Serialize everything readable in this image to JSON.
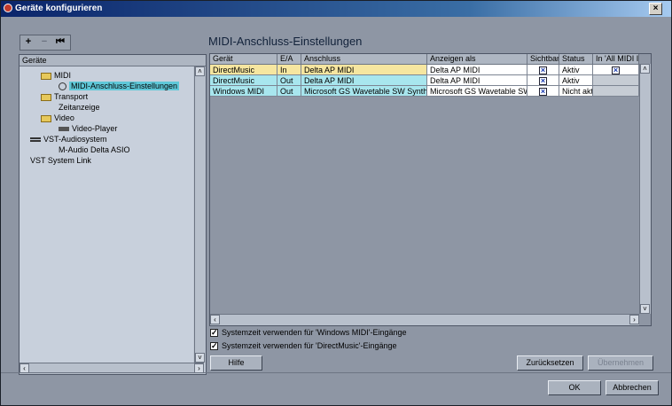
{
  "window": {
    "title": "Geräte konfigurieren",
    "close": "×"
  },
  "toolbar": {
    "add": "+",
    "remove": "−",
    "reset": "⏮"
  },
  "heading": "MIDI-Anschluss-Einstellungen",
  "tree": {
    "header": "Geräte",
    "items": [
      {
        "label": "MIDI",
        "icon": "folder-icon"
      },
      {
        "label": "MIDI-Anschluss-Einstellungen",
        "icon": "midi-port-icon",
        "selected": true
      },
      {
        "label": "Transport",
        "icon": "folder-icon"
      },
      {
        "label": "Zeitanzeige",
        "icon": ""
      },
      {
        "label": "Video",
        "icon": "folder-icon"
      },
      {
        "label": "Video-Player",
        "icon": "video-player-icon"
      },
      {
        "label": "VST-Audiosystem",
        "icon": "audio-system-icon"
      },
      {
        "label": "M-Audio Delta ASIO",
        "icon": ""
      },
      {
        "label": "VST System Link",
        "icon": ""
      }
    ]
  },
  "table": {
    "columns": [
      "Gerät",
      "E/A",
      "Anschluss",
      "Anzeigen als",
      "Sichtbar",
      "Status",
      "In 'All MIDI In"
    ],
    "rows": [
      {
        "geraet": "DirectMusic",
        "ea": "In",
        "anschluss": "Delta AP MIDI",
        "anzeigen": "Delta AP MIDI",
        "sichtbar": true,
        "status": "Aktiv",
        "allmidi": true,
        "color": "#f6e6a0"
      },
      {
        "geraet": "DirectMusic",
        "ea": "Out",
        "anschluss": "Delta AP MIDI",
        "anzeigen": "Delta AP MIDI",
        "sichtbar": true,
        "status": "Aktiv",
        "allmidi": null,
        "color": "#a8e6ee"
      },
      {
        "geraet": "Windows MIDI",
        "ea": "Out",
        "anschluss": "Microsoft GS Wavetable SW Synth",
        "anzeigen": "Microsoft GS Wavetable SW S",
        "sichtbar": true,
        "status": "Nicht akti",
        "allmidi": null,
        "color": "#a8e6ee"
      }
    ]
  },
  "options": {
    "systemzeit_windows": "Systemzeit verwenden für 'Windows MIDI'-Eingänge",
    "systemzeit_directmusic": "Systemzeit verwenden für 'DirectMusic'-Eingänge"
  },
  "buttons": {
    "hilfe": "Hilfe",
    "zuruecksetzen": "Zurücksetzen",
    "uebernehmen": "Übernehmen",
    "ok": "OK",
    "abbrechen": "Abbrechen"
  },
  "colors": {
    "selection": "#5fc8d8",
    "row_in": "#f6e6a0",
    "row_out": "#a8e6ee",
    "titlebar": "#0a246a"
  }
}
